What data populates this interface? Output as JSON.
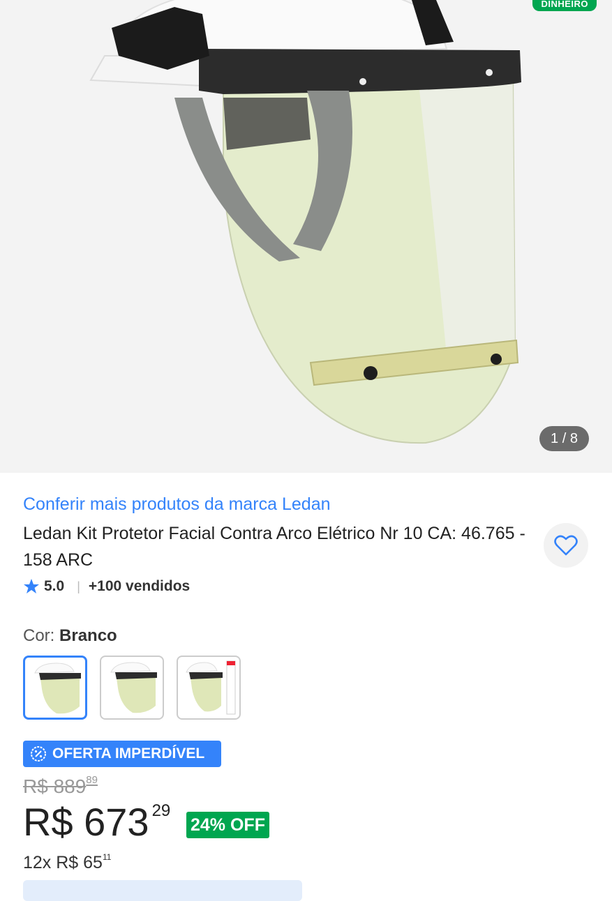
{
  "gallery": {
    "badge": "DINHEIRO",
    "counter": "1 / 8",
    "image_icon": "face-shield-helmet-image"
  },
  "product": {
    "brand_link": "Conferir mais produtos da marca Ledan",
    "title": "Ledan Kit Protetor Facial Contra Arco Elétrico Nr 10 CA: 46.765 - 158 ARC",
    "rating": "5.0",
    "sold": "+100 vendidos",
    "favorite_icon": "heart-icon"
  },
  "variation": {
    "label": "Cor:",
    "value": "Branco",
    "swatches": [
      "swatch-1",
      "swatch-2",
      "swatch-3"
    ]
  },
  "pricing": {
    "offer_label": "OFERTA IMPERDÍVEL",
    "old_price_main": "R$ 889",
    "old_price_cents": "89",
    "price_main": "R$ 673",
    "price_cents": "29",
    "discount": "24% OFF",
    "installments_main": "12x R$ 65",
    "installments_cents": "11"
  },
  "colors": {
    "accent": "#3483fa",
    "success": "#00a650"
  }
}
